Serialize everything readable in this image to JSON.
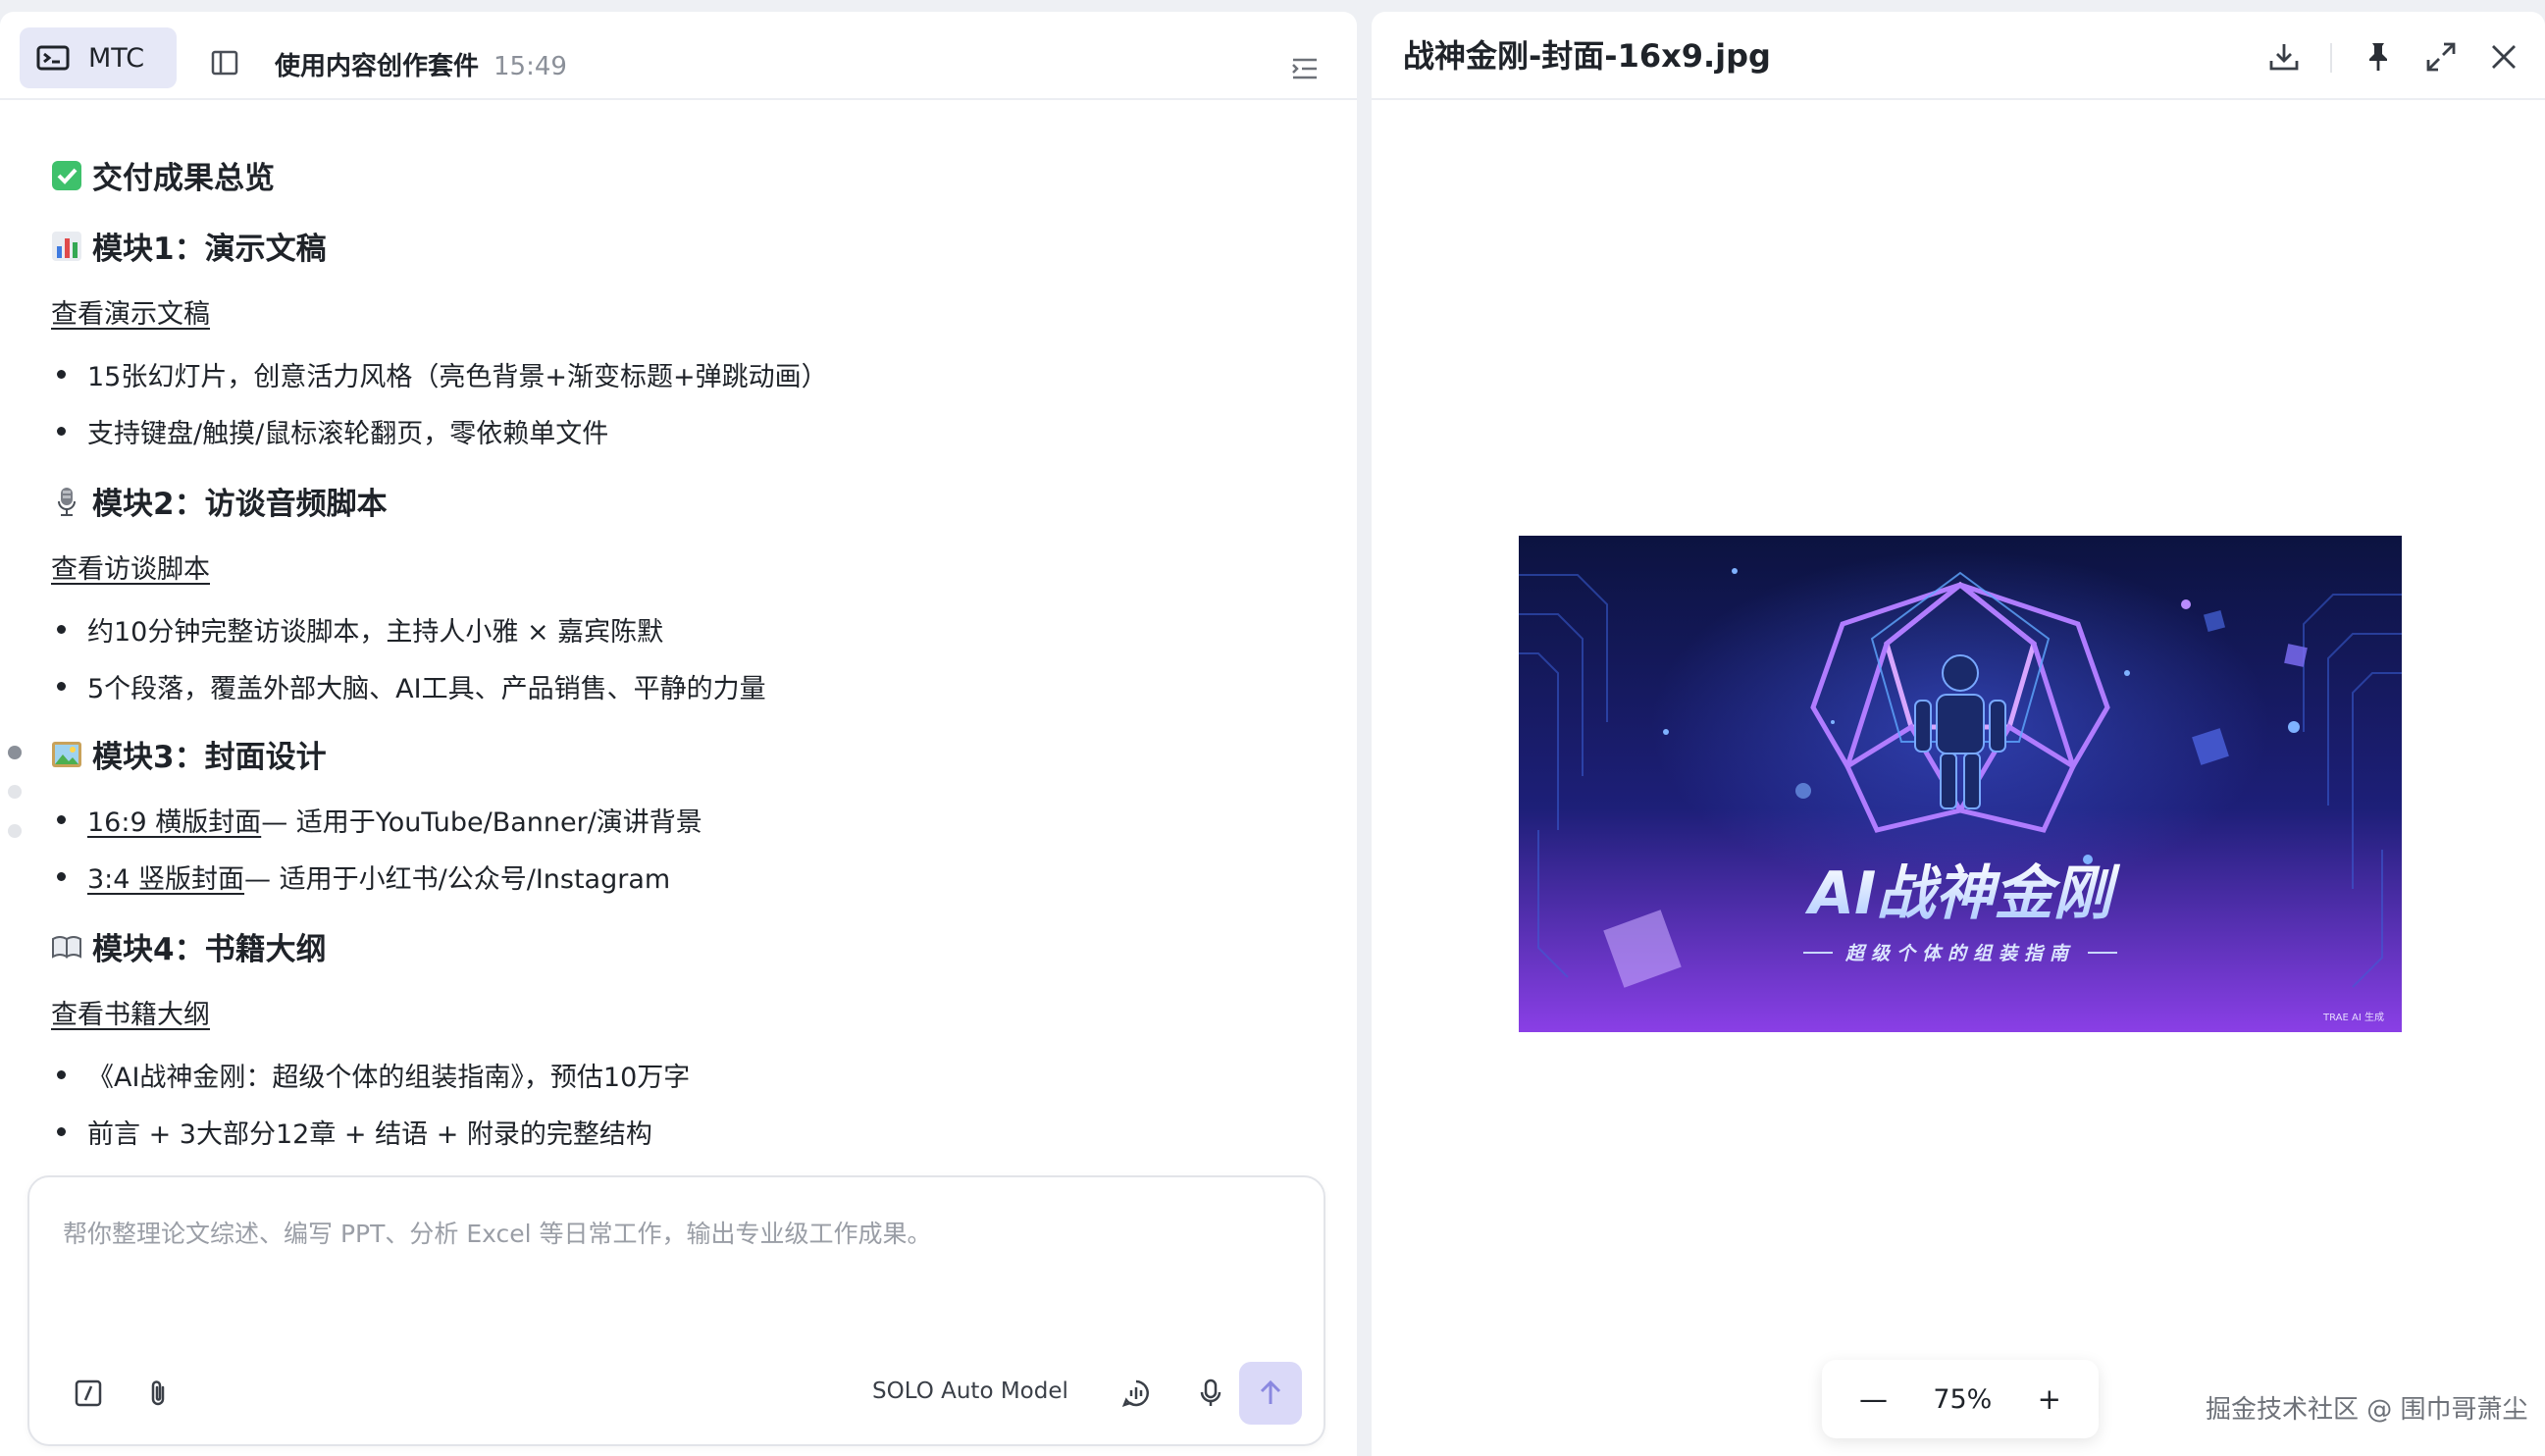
{
  "left": {
    "tab_label": "MTC",
    "session_title": "使用内容创作套件",
    "session_time": "15:49",
    "heading_overview": "交付成果总览",
    "module1": {
      "title": "模块1：演示文稿",
      "link": "查看演示文稿",
      "bullets": [
        "15张幻灯片，创意活力风格（亮色背景+渐变标题+弹跳动画）",
        "支持键盘/触摸/鼠标滚轮翻页，零依赖单文件"
      ]
    },
    "module2": {
      "title": "模块2：访谈音频脚本",
      "link": "查看访谈脚本",
      "bullets": [
        "约10分钟完整访谈脚本，主持人小雅 × 嘉宾陈默",
        "5个段落，覆盖外部大脑、AI工具、产品销售、平静的力量"
      ]
    },
    "module3": {
      "title": "模块3：封面设计",
      "items": [
        {
          "link": "16:9 横版封面",
          "text": " — 适用于YouTube/Banner/演讲背景"
        },
        {
          "link": "3:4 竖版封面",
          "text": " — 适用于小红书/公众号/Instagram"
        }
      ]
    },
    "module4": {
      "title": "模块4：书籍大纲",
      "link": "查看书籍大纲",
      "bullets": [
        "《AI战神金刚：超级个体的组装指南》，预估10万字",
        "前言 + 3大部分12章 + 结语 + 附录的完整结构"
      ]
    },
    "composer": {
      "placeholder": "帮你整理论文综述、编写 PPT、分析 Excel 等日常工作，输出专业级工作成果。",
      "model": "SOLO Auto Model"
    }
  },
  "right": {
    "file_title": "战神金刚-封面-16x9.jpg",
    "cover_title": "AI战神金刚",
    "cover_subtitle": "超级个体的组装指南",
    "cover_tag": "TRAE AI 生成",
    "zoom": "75%",
    "zoom_minus": "—",
    "zoom_plus": "+"
  },
  "watermark": "掘金技术社区 @ 围巾哥萧尘",
  "colors": {
    "accent": "#dad9f8",
    "tab_bg": "#e6e8f7",
    "cover_bg_top": "#0c1340",
    "cover_bg_bottom": "#8a3fe6"
  }
}
